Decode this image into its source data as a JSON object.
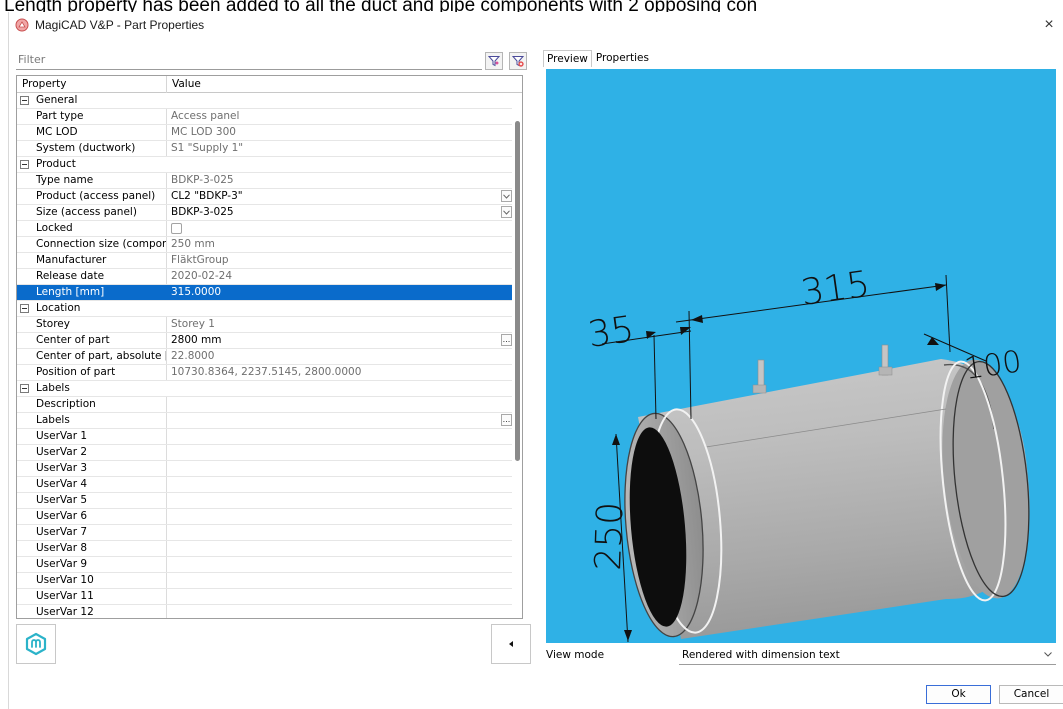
{
  "caption": "Length property has been added to all the duct and pipe components with 2 opposing con",
  "window": {
    "title": "MagiCAD V&P - Part Properties",
    "close_label": "×"
  },
  "filter": {
    "placeholder": "Filter"
  },
  "grid": {
    "headers": {
      "property": "Property",
      "value": "Value"
    },
    "rows": [
      {
        "type": "category",
        "label": "General"
      },
      {
        "type": "prop",
        "label": "Part type",
        "value": "Access panel",
        "editable": false
      },
      {
        "type": "prop",
        "label": "MC LOD",
        "value": "MC LOD 300",
        "editable": false
      },
      {
        "type": "prop",
        "label": "System (ductwork)",
        "value": "S1 \"Supply 1\"",
        "editable": false
      },
      {
        "type": "category",
        "label": "Product"
      },
      {
        "type": "prop",
        "label": "Type name",
        "value": "BDKP-3-025",
        "editable": false
      },
      {
        "type": "prop",
        "label": "Product (access panel)",
        "value": "CL2 \"BDKP-3\"",
        "editable": true,
        "control": "dropdown"
      },
      {
        "type": "prop",
        "label": "Size (access panel)",
        "value": "BDKP-3-025",
        "editable": true,
        "control": "dropdown"
      },
      {
        "type": "prop",
        "label": "Locked",
        "value": "",
        "editable": true,
        "control": "checkbox"
      },
      {
        "type": "prop",
        "label": "Connection size (component)",
        "value": "250 mm",
        "editable": false
      },
      {
        "type": "prop",
        "label": "Manufacturer",
        "value": "FläktGroup",
        "editable": false
      },
      {
        "type": "prop",
        "label": "Release date",
        "value": "2020-02-24",
        "editable": false
      },
      {
        "type": "prop",
        "label": "Length [mm]",
        "value": "315.0000",
        "editable": true,
        "selected": true
      },
      {
        "type": "category",
        "label": "Location"
      },
      {
        "type": "prop",
        "label": "Storey",
        "value": "Storey 1",
        "editable": false
      },
      {
        "type": "prop",
        "label": "Center of part",
        "value": "2800 mm",
        "editable": true,
        "control": "ellipsis"
      },
      {
        "type": "prop",
        "label": "Center of part, absolute [m]",
        "value": "22.8000",
        "editable": false
      },
      {
        "type": "prop",
        "label": "Position of part",
        "value": "10730.8364, 2237.5145, 2800.0000",
        "editable": false
      },
      {
        "type": "category",
        "label": "Labels"
      },
      {
        "type": "prop",
        "label": "Description",
        "value": "",
        "editable": true
      },
      {
        "type": "prop",
        "label": "Labels",
        "value": "",
        "editable": true,
        "control": "ellipsis"
      },
      {
        "type": "prop",
        "label": "UserVar 1",
        "value": "",
        "editable": true
      },
      {
        "type": "prop",
        "label": "UserVar 2",
        "value": "",
        "editable": true
      },
      {
        "type": "prop",
        "label": "UserVar 3",
        "value": "",
        "editable": true
      },
      {
        "type": "prop",
        "label": "UserVar 4",
        "value": "",
        "editable": true
      },
      {
        "type": "prop",
        "label": "UserVar 5",
        "value": "",
        "editable": true
      },
      {
        "type": "prop",
        "label": "UserVar 6",
        "value": "",
        "editable": true
      },
      {
        "type": "prop",
        "label": "UserVar 7",
        "value": "",
        "editable": true
      },
      {
        "type": "prop",
        "label": "UserVar 8",
        "value": "",
        "editable": true
      },
      {
        "type": "prop",
        "label": "UserVar 9",
        "value": "",
        "editable": true
      },
      {
        "type": "prop",
        "label": "UserVar 10",
        "value": "",
        "editable": true
      },
      {
        "type": "prop",
        "label": "UserVar 11",
        "value": "",
        "editable": true
      },
      {
        "type": "prop",
        "label": "UserVar 12",
        "value": "",
        "editable": true
      }
    ]
  },
  "tabs": [
    {
      "label": "Preview",
      "active": true
    },
    {
      "label": "Properties",
      "active": false
    }
  ],
  "preview": {
    "dimensions": {
      "length": "315",
      "offset": "35",
      "end": "100",
      "diameter": "250"
    },
    "background_color": "#2fb1e6"
  },
  "view_mode": {
    "label": "View mode",
    "selected": "Rendered with dimension text"
  },
  "buttons": {
    "ok": "Ok",
    "cancel": "Cancel"
  },
  "colors": {
    "selection": "#0a6bcb",
    "ok_border": "#3a6ed8",
    "logo": "#2bb3c9"
  },
  "icons": {
    "filter_on": "filter-icon",
    "filter_clear": "clear-filter-icon",
    "logo": "magicad-logo-icon",
    "collapse": "triangle-left-icon"
  }
}
